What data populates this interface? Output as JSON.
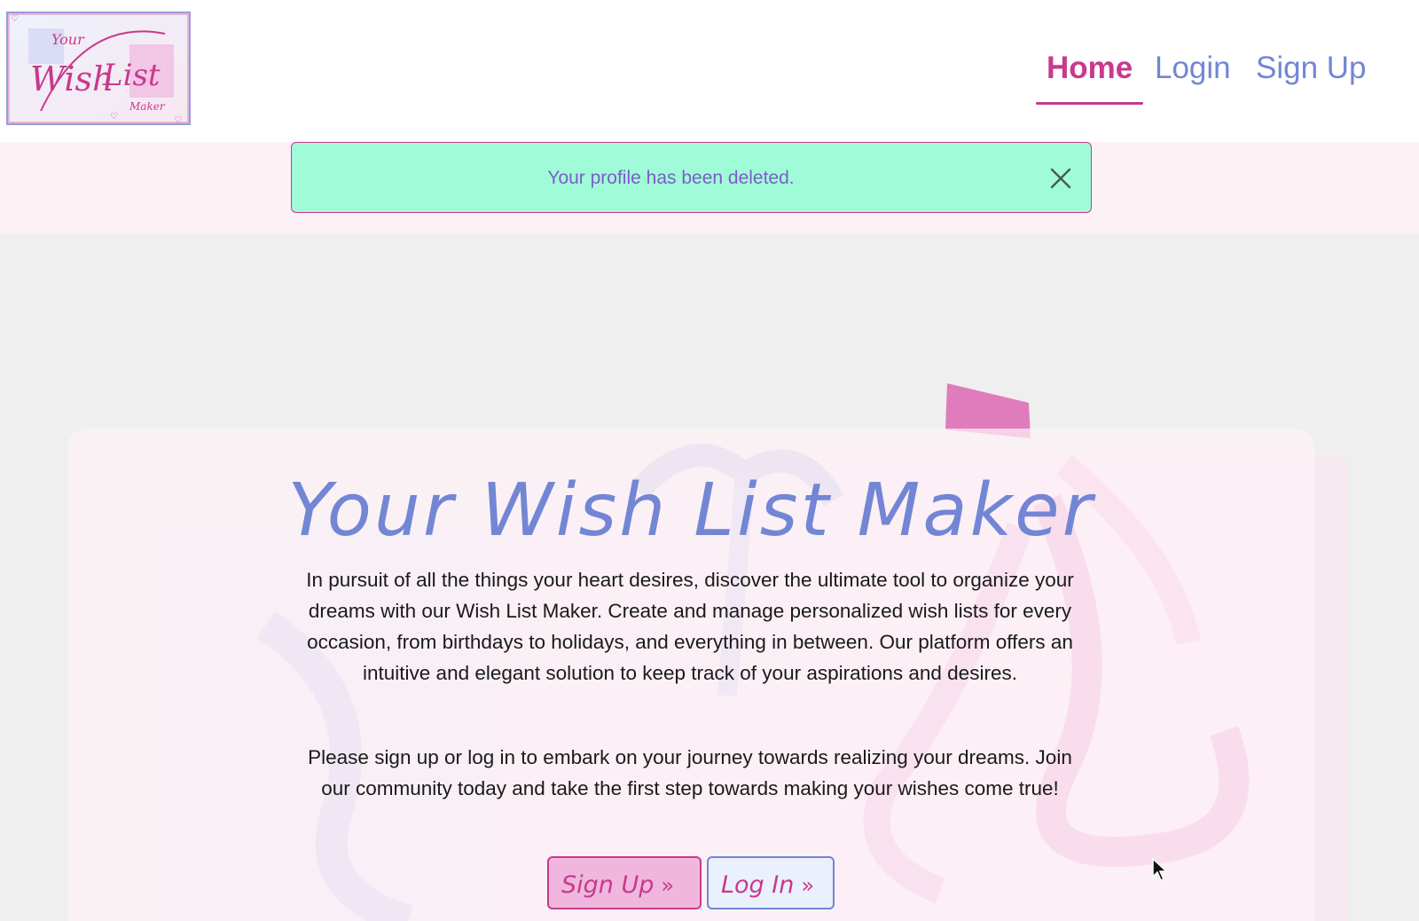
{
  "header": {
    "logo_alt": "Your Wish List Maker",
    "nav": {
      "home": "Home",
      "login": "Login",
      "signup": "Sign Up"
    }
  },
  "alert": {
    "message": "Your profile has been deleted.",
    "close_icon": "close-icon"
  },
  "hero": {
    "title": "Your Wish List Maker",
    "paragraph1": "In pursuit of all the things your heart desires, discover the ultimate tool to organize your dreams with our Wish List Maker. Create and manage personalized wish lists for every occasion, from birthdays to holidays, and everything in between. Our platform offers an intuitive and elegant solution to keep track of your aspirations and desires.",
    "paragraph2": "Please sign up or log in to embark on your journey towards realizing your dreams. Join our community today and take the first step towards making your wishes come true!",
    "signup_button": "Sign Up",
    "login_button": "Log In",
    "chevron_icon": "double-chevron-right-icon"
  },
  "colors": {
    "brand_pink": "#c8398d",
    "brand_blue": "#7386d5",
    "alert_bg": "#a0fbd8",
    "band_bg": "#fcf1f5"
  }
}
